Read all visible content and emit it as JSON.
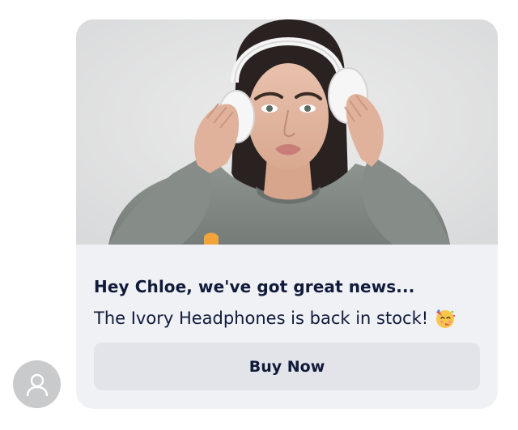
{
  "message": {
    "headline": "Hey Chloe, we've got great news...",
    "body": "The Ivory Headphones is back in stock!",
    "emoji_icon": "partying-face-emoji",
    "button_label": "Buy Now"
  },
  "hero_image": {
    "subject": "woman-wearing-white-headphones"
  },
  "sender_avatar": {
    "icon": "user-icon"
  },
  "colors": {
    "card_background": "#f0f1f5",
    "button_background": "#e3e4e9",
    "text_primary": "#101a3a",
    "avatar_background": "#c9cacc"
  }
}
